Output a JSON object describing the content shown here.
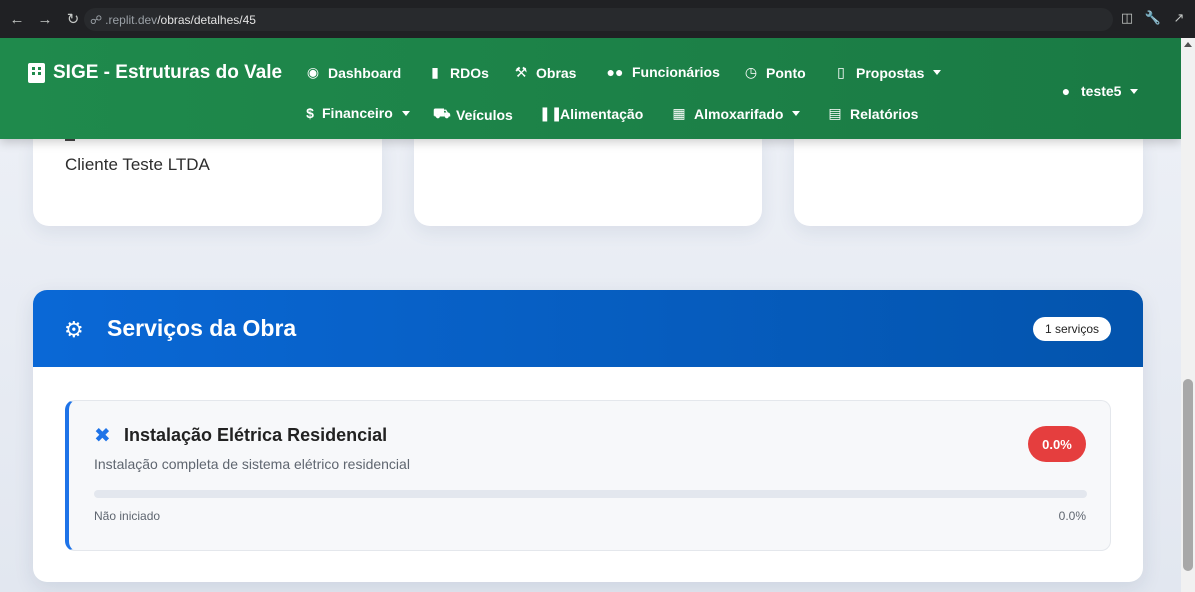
{
  "browser": {
    "url_host": ".replit.dev",
    "url_path": "/obras/detalhes/45",
    "icons": [
      "back-icon",
      "forward-icon",
      "reload-icon",
      "link-icon",
      "devices-icon",
      "wrench-icon",
      "open-external-icon"
    ]
  },
  "navbar": {
    "brand": "SIGE - Estruturas do Vale",
    "row1": [
      {
        "label": "Dashboard",
        "icon": "gauge-icon"
      },
      {
        "label": "RDOs",
        "icon": "clipboard-icon"
      },
      {
        "label": "Obras",
        "icon": "hammer-icon"
      },
      {
        "label": "Funcionários",
        "icon": "users-icon"
      },
      {
        "label": "Ponto",
        "icon": "clock-icon"
      },
      {
        "label": "Propostas",
        "icon": "file-icon",
        "dropdown": true
      }
    ],
    "row2": [
      {
        "label": "Financeiro",
        "icon": "dollar-icon",
        "dropdown": true
      },
      {
        "label": "Veículos",
        "icon": "car-icon"
      },
      {
        "label": "Alimentação",
        "icon": "utensils-icon"
      },
      {
        "label": "Almoxarifado",
        "icon": "boxes-icon",
        "dropdown": true
      },
      {
        "label": "Relatórios",
        "icon": "chart-icon"
      }
    ],
    "user": "teste5"
  },
  "cards": {
    "client_name": "Cliente Teste LTDA"
  },
  "services": {
    "title": "Serviços da Obra",
    "count_badge": "1 serviços",
    "items": [
      {
        "title": "Instalação Elétrica Residencial",
        "description": "Instalação completa de sistema elétrico residencial",
        "percent_label": "0.0%",
        "progress": 0,
        "status": "Não iniciado",
        "status_percent": "0.0%"
      }
    ]
  }
}
